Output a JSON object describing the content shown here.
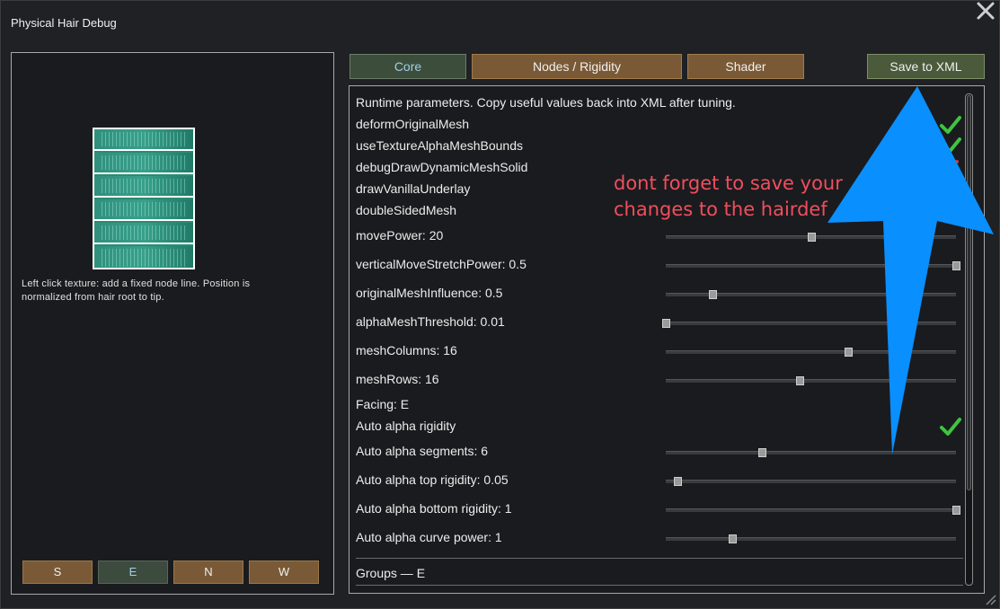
{
  "window": {
    "title": "Physical Hair Debug"
  },
  "left_panel": {
    "help_text": "Left click texture: add a fixed node line. Position is normalized from hair root to tip.",
    "direction_buttons": [
      {
        "label": "S",
        "active": false
      },
      {
        "label": "E",
        "active": true
      },
      {
        "label": "N",
        "active": false
      },
      {
        "label": "W",
        "active": false
      }
    ]
  },
  "tabs": {
    "core": "Core",
    "nodes_rigidity": "Nodes / Rigidity",
    "shader": "Shader",
    "save": "Save to XML"
  },
  "params": {
    "intro": "Runtime parameters. Copy useful values back into XML after tuning.",
    "toggles": [
      {
        "label": "deformOriginalMesh",
        "checked": true
      },
      {
        "label": "useTextureAlphaMeshBounds",
        "checked": true
      },
      {
        "label": "debugDrawDynamicMeshSolid",
        "checked": false
      },
      {
        "label": "drawVanillaUnderlay",
        "checked": false
      },
      {
        "label": "doubleSidedMesh",
        "checked": false
      }
    ],
    "sliders": [
      {
        "label": "movePower: 20",
        "fraction": 0.5
      },
      {
        "label": "verticalMoveStretchPower: 0.5",
        "fraction": 1.0
      },
      {
        "label": "originalMeshInfluence: 0.5",
        "fraction": 0.16
      },
      {
        "label": "alphaMeshThreshold: 0.01",
        "fraction": 0.0
      },
      {
        "label": "meshColumns: 16",
        "fraction": 0.63
      },
      {
        "label": "meshRows: 16",
        "fraction": 0.46
      }
    ],
    "facing": "Facing: E",
    "auto_alpha_rigidity": {
      "label": "Auto alpha rigidity",
      "checked": true
    },
    "auto_sliders": [
      {
        "label": "Auto alpha segments: 6",
        "fraction": 0.33
      },
      {
        "label": "Auto alpha top rigidity: 0.05",
        "fraction": 0.04
      },
      {
        "label": "Auto alpha bottom rigidity: 1",
        "fraction": 1.0
      },
      {
        "label": "Auto alpha curve power: 1",
        "fraction": 0.23
      }
    ],
    "groups_header": "Groups — E"
  },
  "annotation": {
    "line1": "dont forget to save your",
    "line2": "changes to the hairdef",
    "color": "#f04e5e",
    "arrow_color": "#0a8fff"
  }
}
